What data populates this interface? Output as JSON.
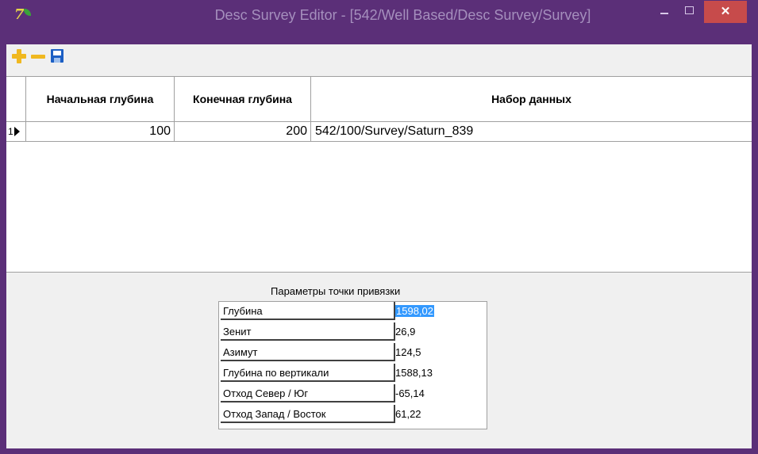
{
  "window": {
    "title": "Desc Survey Editor - [542/Well Based/Desc Survey/Survey]",
    "close_glyph": "✕",
    "app_icon_glyph": "7"
  },
  "toolbar": {
    "icons": [
      "plus-icon",
      "minus-icon",
      "save-icon"
    ],
    "icon_color": "#f0b820",
    "save_color": "#1c5fc4"
  },
  "grid": {
    "columns": [
      "Начальная глубина",
      "Конечная глубина",
      "Набор данных"
    ],
    "rows": [
      {
        "index": "1",
        "start": "100",
        "end": "200",
        "dataset": "542/100/Survey/Saturn_839"
      }
    ]
  },
  "anchor": {
    "caption": "Параметры точки привязки",
    "properties": [
      {
        "label": "Глубина",
        "value": "1598,02"
      },
      {
        "label": "Зенит",
        "value": "26,9"
      },
      {
        "label": "Азимут",
        "value": "124,5"
      },
      {
        "label": "Глубина по вертикали",
        "value": "1588,13"
      },
      {
        "label": "Отход Север / Юг",
        "value": "-65,14"
      },
      {
        "label": "Отход Запад / Восток",
        "value": "61,22"
      }
    ]
  },
  "colors": {
    "frame": "#5b2f78",
    "close": "#c74b4b",
    "selection": "#3399ff"
  }
}
